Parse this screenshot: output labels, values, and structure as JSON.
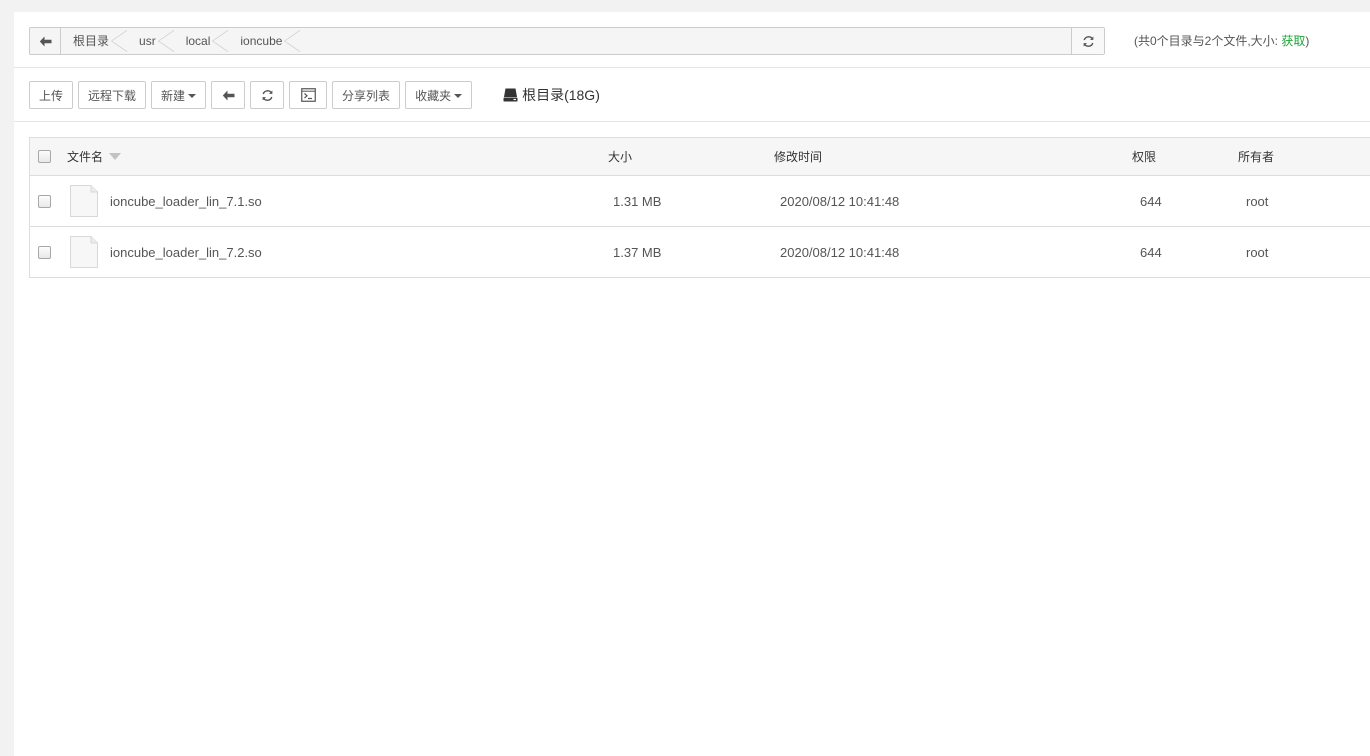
{
  "address_bar": {
    "breadcrumbs": [
      "根目录",
      "usr",
      "local",
      "ioncube"
    ],
    "summary_prefix": "(共0个目录与2个文件,大小: ",
    "summary_link": "获取",
    "summary_suffix": ")"
  },
  "toolbar": {
    "upload": "上传",
    "remote_download": "远程下载",
    "new": "新建",
    "share_list": "分享列表",
    "favorites": "收藏夹",
    "disk_label": "根目录(18G)"
  },
  "table": {
    "headers": {
      "name": "文件名",
      "size": "大小",
      "mtime": "修改时间",
      "perm": "权限",
      "owner": "所有者"
    },
    "rows": [
      {
        "name": "ioncube_loader_lin_7.1.so",
        "size": "1.31 MB",
        "mtime": "2020/08/12 10:41:48",
        "perm": "644",
        "owner": "root"
      },
      {
        "name": "ioncube_loader_lin_7.2.so",
        "size": "1.37 MB",
        "mtime": "2020/08/12 10:41:48",
        "perm": "644",
        "owner": "root"
      }
    ]
  },
  "colors": {
    "accent_green": "#20a53a",
    "border": "#cccccc",
    "header_bg": "#f6f6f6"
  }
}
